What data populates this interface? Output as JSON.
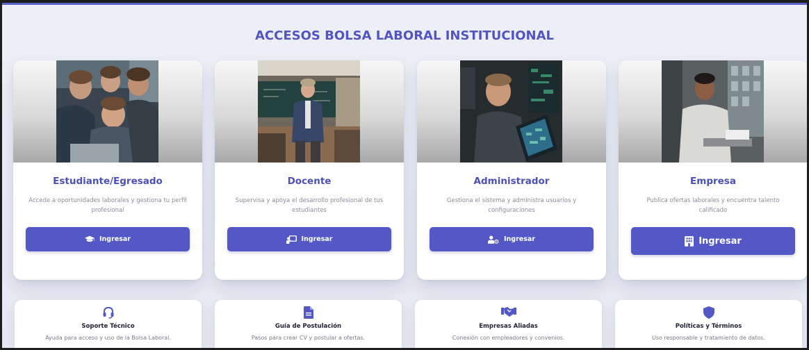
{
  "page": {
    "title": "ACCESOS BOLSA LABORAL INSTITUCIONAL"
  },
  "roles": [
    {
      "title": "Estudiante/Egresado",
      "description": "Accede a oportunidades laborales y gestiona tu perfil profesional",
      "button_label": "Ingresar",
      "button_icon": "graduation-cap-icon"
    },
    {
      "title": "Docente",
      "description": "Supervisa y apoya el desarrollo profesional de tus estudiantes",
      "button_label": "Ingresar",
      "button_icon": "chalkboard-teacher-icon"
    },
    {
      "title": "Administrador",
      "description": "Gestiona el sistema y administra usuarios y configuraciones",
      "button_label": "Ingresar",
      "button_icon": "user-gear-icon"
    },
    {
      "title": "Empresa",
      "description": "Publica ofertas laborales y encuentra talento calificado",
      "button_label": "Ingresar",
      "button_icon": "building-icon"
    }
  ],
  "info_cards": [
    {
      "title": "Soporte Técnico",
      "description": "Ayuda para acceso y uso de la Bolsa Laboral.",
      "icon": "headset-icon"
    },
    {
      "title": "Guía de Postulación",
      "description": "Pasos para crear CV y postular a ofertas.",
      "icon": "document-icon"
    },
    {
      "title": "Empresas Aliadas",
      "description": "Conexión con empleadores y convenios.",
      "icon": "handshake-icon"
    },
    {
      "title": "Políticas y Términos",
      "description": "Uso responsable y tratamiento de datos.",
      "icon": "shield-icon"
    }
  ],
  "colors": {
    "accent": "#5358c6",
    "title": "#5155c0",
    "role_title": "#4c4fb6",
    "muted_text": "#8a8d99",
    "background": "#eef0f8"
  }
}
